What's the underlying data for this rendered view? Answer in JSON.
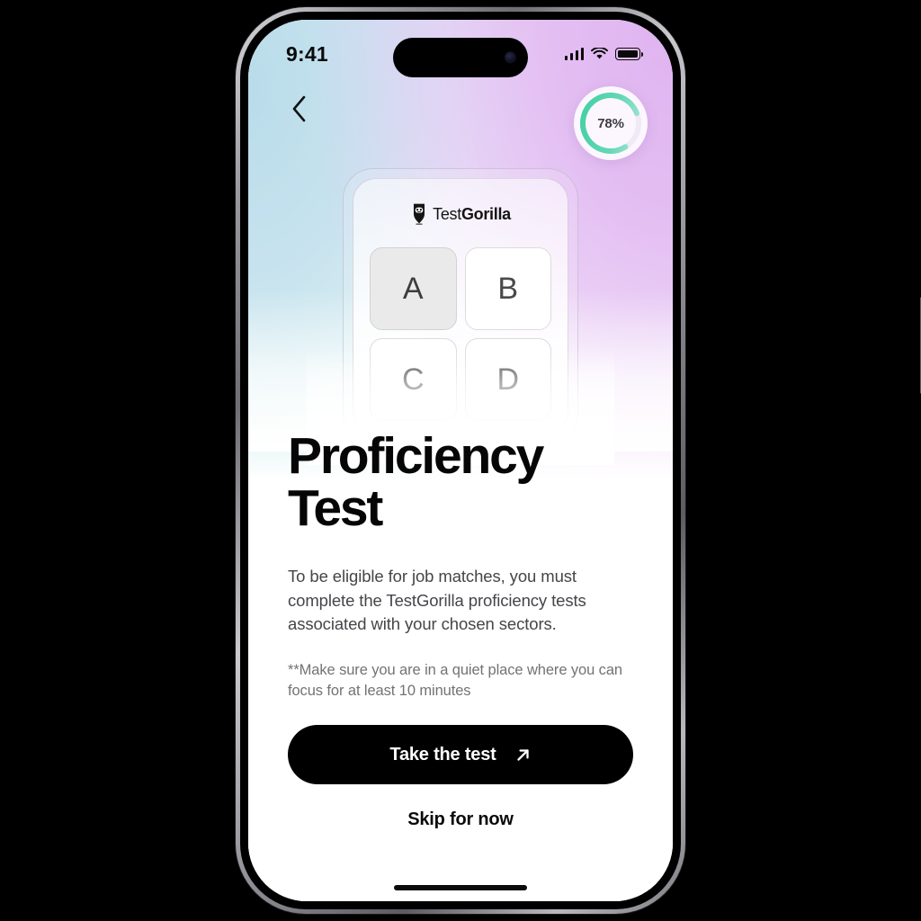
{
  "status_bar": {
    "time": "9:41",
    "signal_icon": "cellular-signal-icon",
    "wifi_icon": "wifi-icon",
    "battery_icon": "battery-full-icon"
  },
  "header": {
    "back_icon": "chevron-left-icon",
    "progress": {
      "label": "78%",
      "value": 78,
      "track_color": "#ece7f2",
      "arc_color_start": "#3ecfa0",
      "arc_color_end": "#9fe3d2"
    }
  },
  "card": {
    "brand_logo_icon": "gorilla-head-logo-icon",
    "brand_name_light": "Test",
    "brand_name_bold": "Gorilla",
    "options": [
      {
        "label": "A",
        "selected": true
      },
      {
        "label": "B",
        "selected": false
      },
      {
        "label": "C",
        "selected": false
      },
      {
        "label": "D",
        "selected": false
      }
    ]
  },
  "content": {
    "title_line1": "Proficiency",
    "title_line2": "Test",
    "body": "To be eligible for job matches, you must complete the TestGorilla proficiency tests associated with your chosen sectors.",
    "note": "**Make sure you are in a quiet place where you can focus for at least 10 minutes",
    "primary_button": {
      "label": "Take the test",
      "icon": "arrow-up-right-icon",
      "background": "#000000",
      "text_color": "#ffffff"
    },
    "secondary_button": {
      "label": "Skip for now"
    }
  },
  "theme": {
    "gradient_top_right": "#e0b4f0",
    "gradient_top_left": "#b9dcea",
    "gradient_mid_left": "#d7f3ec",
    "page_background": "#ffffff",
    "accent": "#3ecfa0"
  }
}
